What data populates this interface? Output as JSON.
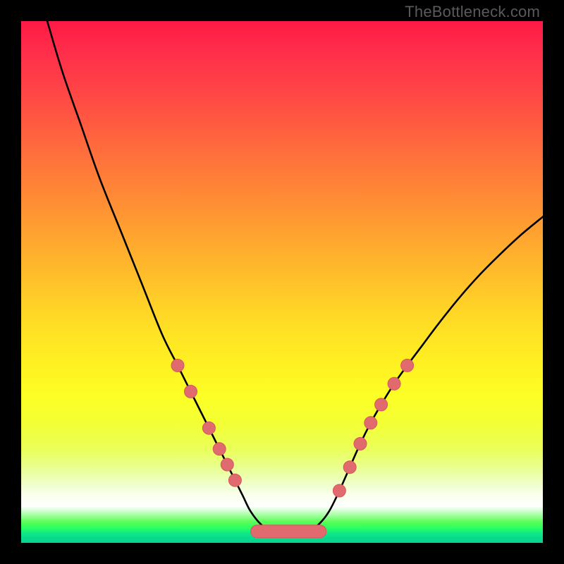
{
  "watermark": "TheBottleneck.com",
  "colors": {
    "frame": "#000000",
    "curve": "#000000",
    "marker_fill": "#e06a6d",
    "marker_stroke": "#d45a5d"
  },
  "chart_data": {
    "type": "line",
    "title": "",
    "xlabel": "",
    "ylabel": "",
    "xlim": [
      0,
      100
    ],
    "ylim": [
      0,
      100
    ],
    "note": "Axes are unlabeled in the source image; coordinates are read as percent of the inner plot area (0,0 = top-left, 100,100 = bottom), curve visually represents bottleneck percentage vs. an unspecified x variable.",
    "series": [
      {
        "name": "curve",
        "stroke": "#000000",
        "points": [
          {
            "x": 5.0,
            "y": 0.0
          },
          {
            "x": 8.0,
            "y": 10.0
          },
          {
            "x": 11.5,
            "y": 20.0
          },
          {
            "x": 15.0,
            "y": 30.0
          },
          {
            "x": 19.0,
            "y": 40.0
          },
          {
            "x": 23.0,
            "y": 50.0
          },
          {
            "x": 27.0,
            "y": 60.0
          },
          {
            "x": 30.0,
            "y": 66.0
          },
          {
            "x": 32.5,
            "y": 71.0
          },
          {
            "x": 34.5,
            "y": 75.0
          },
          {
            "x": 36.0,
            "y": 78.0
          },
          {
            "x": 38.0,
            "y": 82.0
          },
          {
            "x": 39.5,
            "y": 85.0
          },
          {
            "x": 41.0,
            "y": 88.0
          },
          {
            "x": 42.5,
            "y": 91.0
          },
          {
            "x": 44.0,
            "y": 94.0
          },
          {
            "x": 46.0,
            "y": 96.5
          },
          {
            "x": 48.0,
            "y": 97.8
          },
          {
            "x": 50.0,
            "y": 98.2
          },
          {
            "x": 52.5,
            "y": 98.2
          },
          {
            "x": 55.0,
            "y": 97.8
          },
          {
            "x": 57.0,
            "y": 96.5
          },
          {
            "x": 59.0,
            "y": 94.0
          },
          {
            "x": 61.0,
            "y": 90.0
          },
          {
            "x": 63.0,
            "y": 85.5
          },
          {
            "x": 65.0,
            "y": 81.0
          },
          {
            "x": 67.0,
            "y": 77.0
          },
          {
            "x": 69.0,
            "y": 73.5
          },
          {
            "x": 71.5,
            "y": 69.5
          },
          {
            "x": 74.0,
            "y": 66.0
          },
          {
            "x": 77.0,
            "y": 62.0
          },
          {
            "x": 80.0,
            "y": 58.0
          },
          {
            "x": 84.0,
            "y": 53.0
          },
          {
            "x": 88.0,
            "y": 48.5
          },
          {
            "x": 92.0,
            "y": 44.5
          },
          {
            "x": 96.0,
            "y": 40.8
          },
          {
            "x": 100.0,
            "y": 37.5
          }
        ]
      },
      {
        "name": "left-markers",
        "marker": "circle",
        "points": [
          {
            "x": 30.0,
            "y": 66.0
          },
          {
            "x": 32.5,
            "y": 71.0
          },
          {
            "x": 36.0,
            "y": 78.0
          },
          {
            "x": 38.0,
            "y": 82.0
          },
          {
            "x": 39.5,
            "y": 85.0
          },
          {
            "x": 41.0,
            "y": 88.0
          }
        ]
      },
      {
        "name": "right-markers",
        "marker": "circle",
        "points": [
          {
            "x": 61.0,
            "y": 90.0
          },
          {
            "x": 63.0,
            "y": 85.5
          },
          {
            "x": 65.0,
            "y": 81.0
          },
          {
            "x": 67.0,
            "y": 77.0
          },
          {
            "x": 69.0,
            "y": 73.5
          },
          {
            "x": 71.5,
            "y": 69.5
          },
          {
            "x": 74.0,
            "y": 66.0
          }
        ]
      },
      {
        "name": "valley-band",
        "marker": "rounded-rect",
        "note": "flattened salmon band across the valley floor",
        "points": [
          {
            "x": 44.0,
            "y": 97.8
          },
          {
            "x": 58.5,
            "y": 97.8
          }
        ]
      }
    ]
  }
}
